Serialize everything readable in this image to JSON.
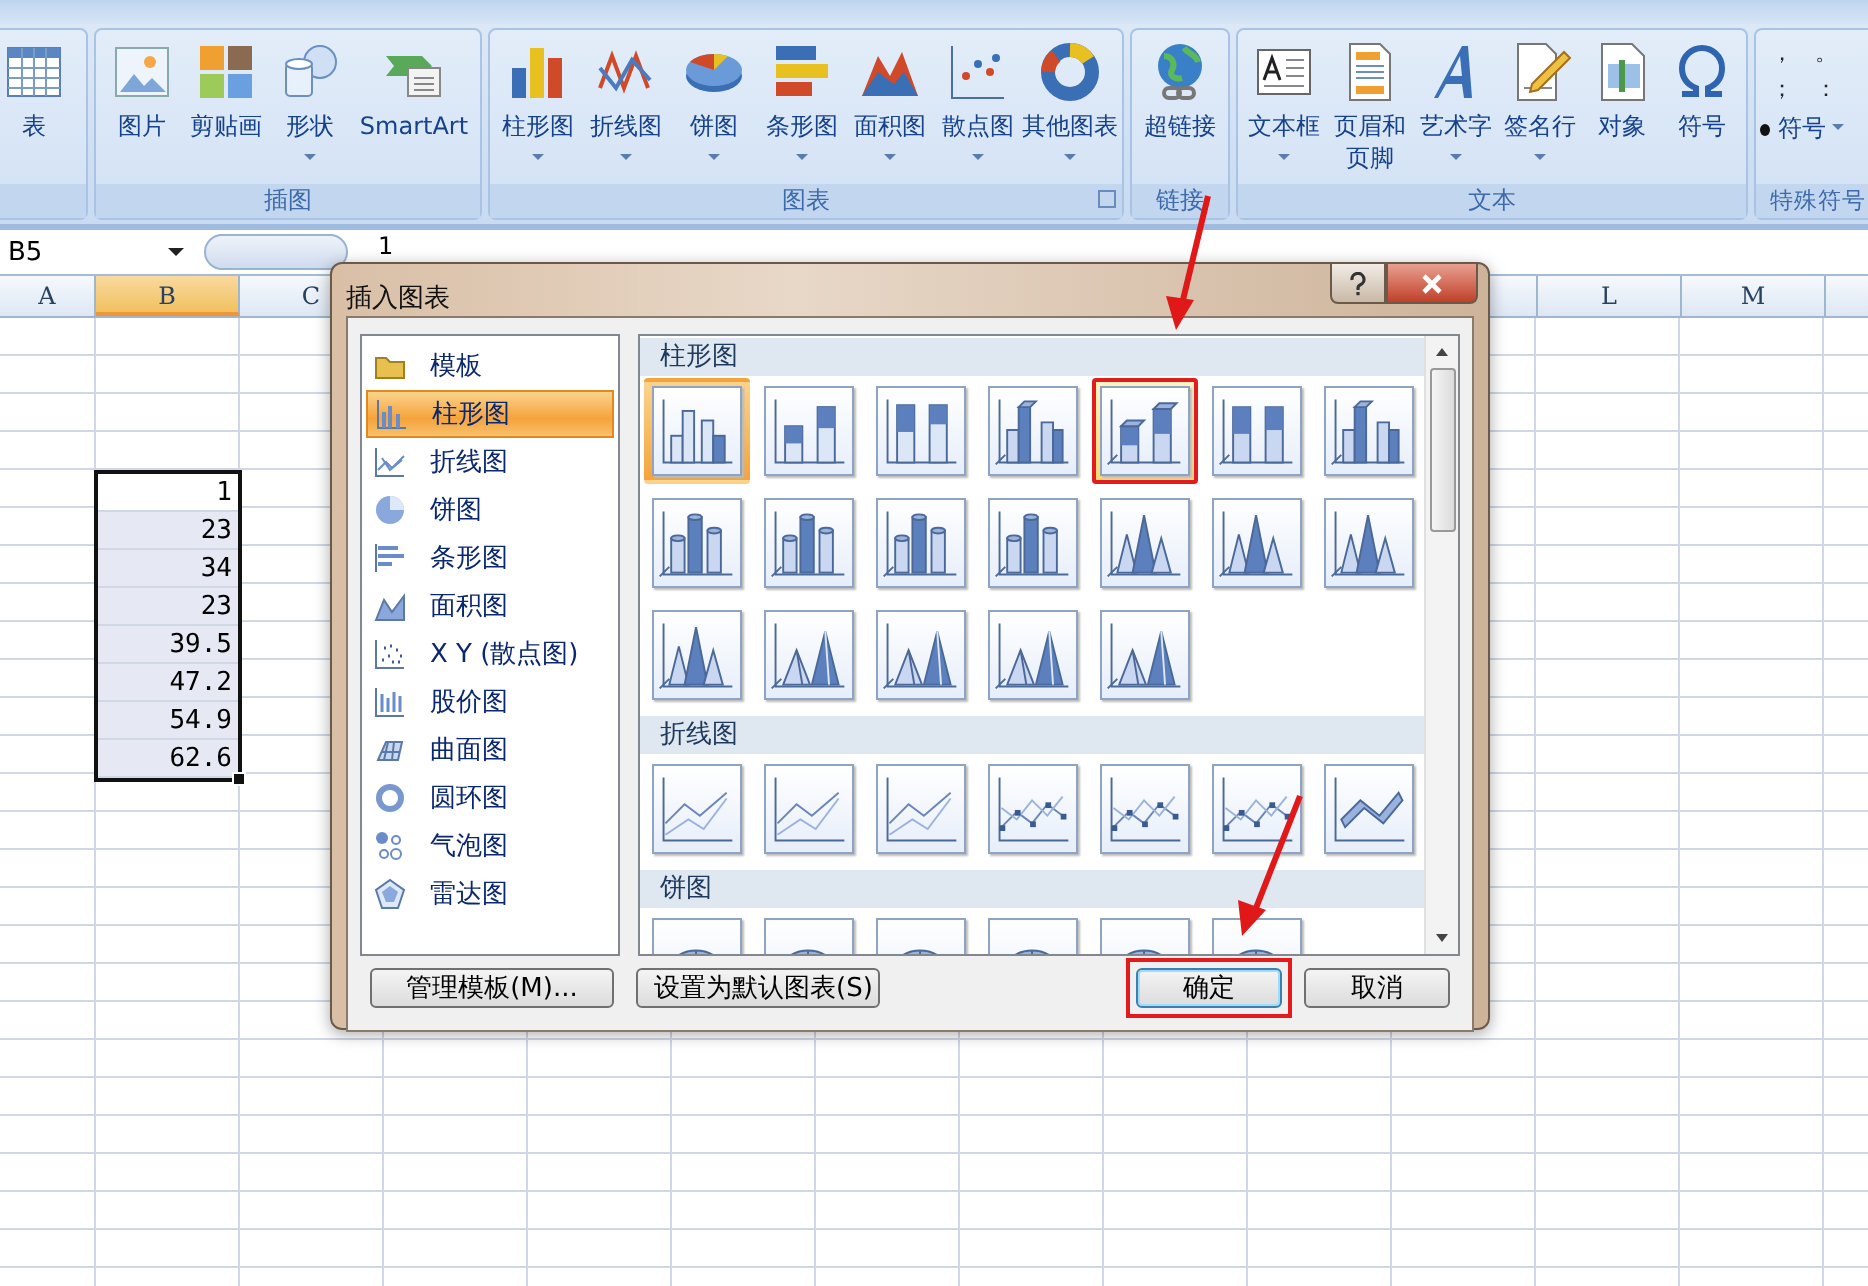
{
  "ribbon": {
    "groups": [
      {
        "buttons": [
          {
            "label": "表",
            "kind": "table",
            "dropdown": false
          }
        ]
      },
      {
        "label": "插图",
        "buttons": [
          {
            "label": "图片",
            "kind": "picture",
            "dropdown": false
          },
          {
            "label": "剪贴画",
            "kind": "clipart",
            "dropdown": false
          },
          {
            "label": "形状",
            "kind": "shapes",
            "dropdown": true
          },
          {
            "label": "SmartArt",
            "kind": "smartart",
            "dropdown": false
          }
        ]
      },
      {
        "label": "图表",
        "launcher": true,
        "buttons": [
          {
            "label": "柱形图",
            "kind": "column",
            "dropdown": true
          },
          {
            "label": "折线图",
            "kind": "line",
            "dropdown": true
          },
          {
            "label": "饼图",
            "kind": "pie",
            "dropdown": true
          },
          {
            "label": "条形图",
            "kind": "bar",
            "dropdown": true
          },
          {
            "label": "面积图",
            "kind": "area",
            "dropdown": true
          },
          {
            "label": "散点图",
            "kind": "scatter",
            "dropdown": true
          },
          {
            "label": "其他图表",
            "kind": "other",
            "dropdown": true
          }
        ]
      },
      {
        "label": "链接",
        "buttons": [
          {
            "label": "超链接",
            "kind": "hyperlink",
            "dropdown": false
          }
        ]
      },
      {
        "label": "文本",
        "buttons": [
          {
            "label": "文本框",
            "kind": "textbox",
            "dropdown": true
          },
          {
            "label": "页眉和页脚",
            "kind": "header",
            "dropdown": false
          },
          {
            "label": "艺术字",
            "kind": "wordart",
            "dropdown": true
          },
          {
            "label": "签名行",
            "kind": "signature",
            "dropdown": true
          },
          {
            "label": "对象",
            "kind": "object",
            "dropdown": false
          },
          {
            "label": "符号",
            "kind": "symbol",
            "dropdown": false
          }
        ]
      },
      {
        "label": "特殊符号",
        "symbols": [
          "，",
          "。",
          "；",
          "："
        ],
        "symbol_button": "符号"
      }
    ]
  },
  "formula_bar": {
    "name_box": "B5",
    "value": "1"
  },
  "sheet": {
    "columns_left": [
      {
        "label": "A",
        "selected": false
      },
      {
        "label": "B",
        "selected": true
      },
      {
        "label": "C",
        "selected": false
      }
    ],
    "columns_right": [
      {
        "label": "L",
        "selected": false
      },
      {
        "label": "M",
        "selected": false
      }
    ],
    "cells": [
      {
        "value": "1",
        "active": true
      },
      {
        "value": "23",
        "active": false
      },
      {
        "value": "34",
        "active": false
      },
      {
        "value": "23",
        "active": false
      },
      {
        "value": "39.5",
        "active": false
      },
      {
        "value": "47.2",
        "active": false
      },
      {
        "value": "54.9",
        "active": false
      },
      {
        "value": "62.6",
        "active": false
      }
    ]
  },
  "dialog": {
    "title": "插入图表",
    "types": [
      {
        "label": "模板",
        "kind": "template",
        "selected": false
      },
      {
        "label": "柱形图",
        "kind": "column",
        "selected": true
      },
      {
        "label": "折线图",
        "kind": "line",
        "selected": false
      },
      {
        "label": "饼图",
        "kind": "pie",
        "selected": false
      },
      {
        "label": "条形图",
        "kind": "bar",
        "selected": false
      },
      {
        "label": "面积图",
        "kind": "area",
        "selected": false
      },
      {
        "label": "X Y (散点图)",
        "kind": "scatter",
        "selected": false
      },
      {
        "label": "股价图",
        "kind": "stock",
        "selected": false
      },
      {
        "label": "曲面图",
        "kind": "surface",
        "selected": false
      },
      {
        "label": "圆环图",
        "kind": "doughnut",
        "selected": false
      },
      {
        "label": "气泡图",
        "kind": "bubble",
        "selected": false
      },
      {
        "label": "雷达图",
        "kind": "radar",
        "selected": false
      }
    ],
    "sections": [
      {
        "title": "柱形图",
        "items": [
          {
            "kind": "col2d",
            "selected": true,
            "hovered": false,
            "highlighted": false
          },
          {
            "kind": "stack2d",
            "selected": false,
            "hovered": false,
            "highlighted": false
          },
          {
            "kind": "full2d",
            "selected": false,
            "hovered": false,
            "highlighted": false
          },
          {
            "kind": "col3d",
            "selected": false,
            "hovered": false,
            "highlighted": false
          },
          {
            "kind": "stack3d",
            "selected": false,
            "hovered": true,
            "highlighted": true
          },
          {
            "kind": "full3d",
            "selected": false,
            "hovered": false,
            "highlighted": false
          },
          {
            "kind": "col3d",
            "selected": false,
            "hovered": false,
            "highlighted": false
          },
          {
            "kind": "cylinder",
            "selected": false,
            "hovered": false,
            "highlighted": false
          },
          {
            "kind": "cylinder",
            "selected": false,
            "hovered": false,
            "highlighted": false
          },
          {
            "kind": "cylinder",
            "selected": false,
            "hovered": false,
            "highlighted": false
          },
          {
            "kind": "cylinder",
            "selected": false,
            "hovered": false,
            "highlighted": false
          },
          {
            "kind": "cone",
            "selected": false,
            "hovered": false,
            "highlighted": false
          },
          {
            "kind": "cone",
            "selected": false,
            "hovered": false,
            "highlighted": false
          },
          {
            "kind": "cone",
            "selected": false,
            "hovered": false,
            "highlighted": false
          },
          {
            "kind": "cone",
            "selected": false,
            "hovered": false,
            "highlighted": false
          },
          {
            "kind": "pyramid",
            "selected": false,
            "hovered": false,
            "highlighted": false
          },
          {
            "kind": "pyramid",
            "selected": false,
            "hovered": false,
            "highlighted": false
          },
          {
            "kind": "pyramid",
            "selected": false,
            "hovered": false,
            "highlighted": false
          },
          {
            "kind": "pyramid",
            "selected": false,
            "hovered": false,
            "highlighted": false
          }
        ]
      },
      {
        "title": "折线图",
        "items": [
          {
            "kind": "line",
            "selected": false,
            "hovered": false,
            "highlighted": false
          },
          {
            "kind": "line",
            "selected": false,
            "hovered": false,
            "highlighted": false
          },
          {
            "kind": "line",
            "selected": false,
            "hovered": false,
            "highlighted": false
          },
          {
            "kind": "linemark",
            "selected": false,
            "hovered": false,
            "highlighted": false
          },
          {
            "kind": "linemark",
            "selected": false,
            "hovered": false,
            "highlighted": false
          },
          {
            "kind": "linemark",
            "selected": false,
            "hovered": false,
            "highlighted": false
          },
          {
            "kind": "line3d",
            "selected": false,
            "hovered": false,
            "highlighted": false
          }
        ]
      },
      {
        "title": "饼图",
        "items": [
          {
            "kind": "pie",
            "selected": false,
            "hovered": false,
            "highlighted": false
          },
          {
            "kind": "pie",
            "selected": false,
            "hovered": false,
            "highlighted": false
          },
          {
            "kind": "pie",
            "selected": false,
            "hovered": false,
            "highlighted": false
          },
          {
            "kind": "pie",
            "selected": false,
            "hovered": false,
            "highlighted": false
          },
          {
            "kind": "pie",
            "selected": false,
            "hovered": false,
            "highlighted": false
          },
          {
            "kind": "pie",
            "selected": false,
            "hovered": false,
            "highlighted": false
          }
        ]
      }
    ],
    "buttons": [
      {
        "label": "管理模板(M)...",
        "kind": "secondary",
        "default": false,
        "highlighted": false
      },
      {
        "label": "设置为默认图表(S)",
        "kind": "secondary",
        "default": false,
        "highlighted": false
      },
      {
        "label": "确定",
        "kind": "primary",
        "default": true,
        "highlighted": true
      },
      {
        "label": "取消",
        "kind": "primary",
        "default": false,
        "highlighted": false
      }
    ]
  }
}
